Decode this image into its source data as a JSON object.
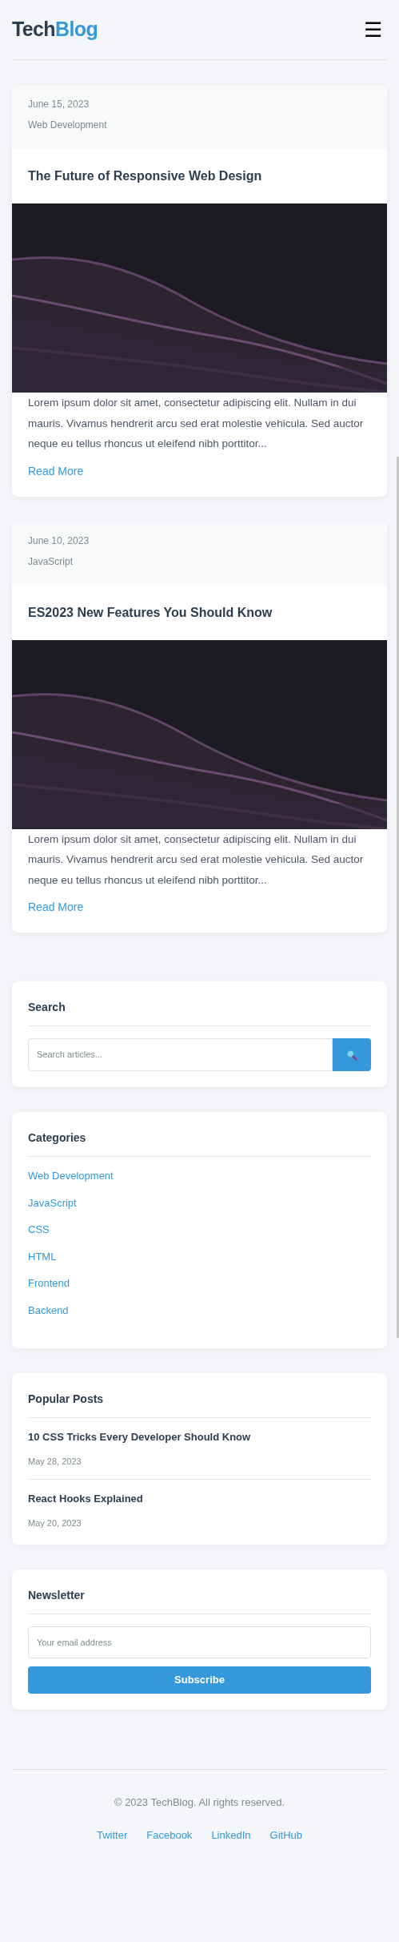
{
  "header": {
    "logo": [
      "Tech",
      "Blog"
    ],
    "menu_icon": "☰"
  },
  "posts": [
    {
      "date": "June 15, 2023",
      "category": "Web Development",
      "title": "The Future of Responsive Web Design",
      "excerpt": "Lorem ipsum dolor sit amet, consectetur adipiscing elit. Nullam in dui mauris. Vivamus hendrerit arcu sed erat molestie vehicula. Sed auctor neque eu tellus rhoncus ut eleifend nibh porttitor...",
      "link": "Read More"
    },
    {
      "date": "June 10, 2023",
      "category": "JavaScript",
      "title": "ES2023 New Features You Should Know",
      "excerpt": "Lorem ipsum dolor sit amet, consectetur adipiscing elit. Nullam in dui mauris. Vivamus hendrerit arcu sed erat molestie vehicula. Sed auctor neque eu tellus rhoncus ut eleifend nibh porttitor...",
      "link": "Read More"
    }
  ],
  "search": {
    "title": "Search",
    "placeholder": "Search articles..."
  },
  "categories": {
    "title": "Categories",
    "items": [
      "Web Development",
      "JavaScript",
      "CSS",
      "HTML",
      "Frontend",
      "Backend"
    ]
  },
  "popular_posts": {
    "title": "Popular Posts",
    "items": [
      {
        "title": "10 CSS Tricks Every Developer Should Know",
        "date": "May 28, 2023"
      },
      {
        "title": "React Hooks Explained",
        "date": "May 20, 2023"
      }
    ]
  },
  "newsletter": {
    "title": "Newsletter",
    "placeholder": "Your email address",
    "button": "Subscribe"
  },
  "footer": {
    "copyright": "© 2023 TechBlog. All rights reserved.",
    "links": [
      "Twitter",
      "Facebook",
      "LinkedIn",
      "GitHub"
    ]
  }
}
